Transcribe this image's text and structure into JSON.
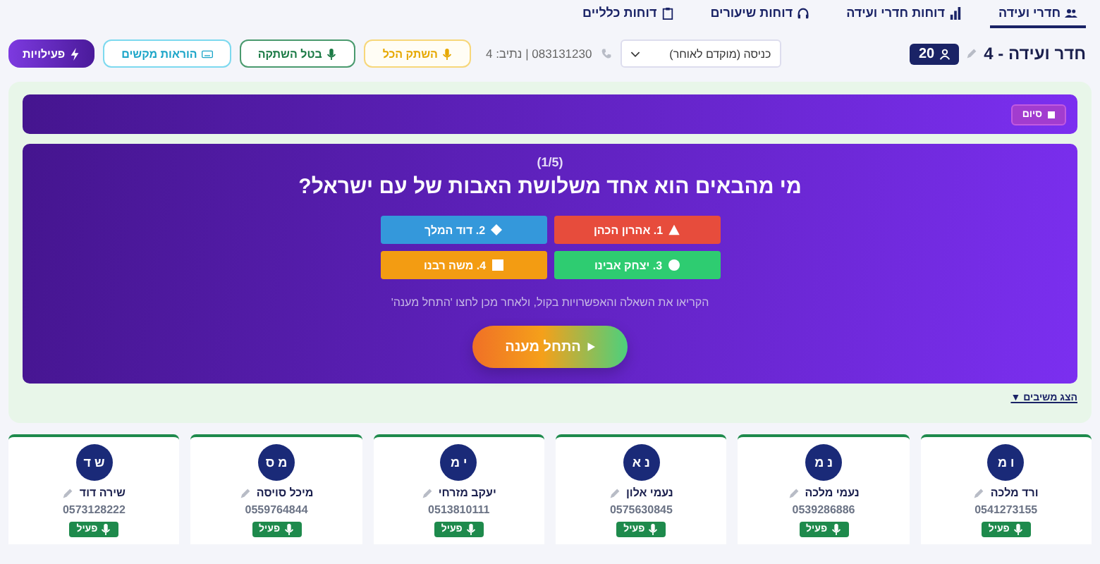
{
  "nav_tabs": [
    {
      "label": "חדרי ועידה",
      "kind": "people",
      "selected": true
    },
    {
      "label": "דוחות חדרי ועידה",
      "kind": "chart",
      "selected": false
    },
    {
      "label": "דוחות שיעורים",
      "kind": "headphones",
      "selected": false
    },
    {
      "label": "דוחות כלליים",
      "kind": "clipboard",
      "selected": false
    }
  ],
  "room": {
    "title": "חדר ועידה - 4",
    "participants": "20"
  },
  "sort_select": {
    "value": "כניסה (מוקדם לאוחר)"
  },
  "line_info": "083131230 | נתיב: 4",
  "toolbar_buttons": [
    {
      "label": "השתק הכל",
      "kind": "mute"
    },
    {
      "label": "בטל השתקה",
      "kind": "unmute"
    },
    {
      "label": "הוראות מקשים",
      "kind": "keys"
    },
    {
      "label": "פעילויות",
      "kind": "activities"
    }
  ],
  "end_button": "סיום",
  "quiz": {
    "progress": "(1/5)",
    "question": "מי מהבאים הוא אחד משלושת האבות של עם ישראל?",
    "answers": [
      {
        "label": "1. אהרון הכהן",
        "kind": "triangle",
        "color": "#e74c3c"
      },
      {
        "label": "2. דוד המלך",
        "kind": "diamond",
        "color": "#3498db"
      },
      {
        "label": "3. יצחק אבינו",
        "kind": "circle",
        "color": "#2ecc71"
      },
      {
        "label": "4. משה רבנו",
        "kind": "square",
        "color": "#f39c12"
      }
    ],
    "instruction": "הקריאו את השאלה והאפשרויות בקול, ולאחר מכן לחצו 'התחל מענה'",
    "start_button": "התחל מענה"
  },
  "show_responders": "הצג משיבים ▼",
  "participants": [
    {
      "initials": "ו מ",
      "name": "ורד מלכה",
      "phone": "0541273155",
      "status": "פעיל",
      "active": true
    },
    {
      "initials": "נ מ",
      "name": "נעמי מלכה",
      "phone": "0539286886",
      "status": "פעיל",
      "active": true
    },
    {
      "initials": "נ א",
      "name": "נעמי אלון",
      "phone": "0575630845",
      "status": "פעיל",
      "active": true
    },
    {
      "initials": "י מ",
      "name": "יעקב מזרחי",
      "phone": "0513810111",
      "status": "פעיל",
      "active": true
    },
    {
      "initials": "מ ס",
      "name": "מיכל סויסה",
      "phone": "0559764844",
      "status": "פעיל",
      "active": true
    },
    {
      "initials": "ש ד",
      "name": "שירה דוד",
      "phone": "0573128222",
      "status": "פעיל",
      "active": true
    }
  ]
}
